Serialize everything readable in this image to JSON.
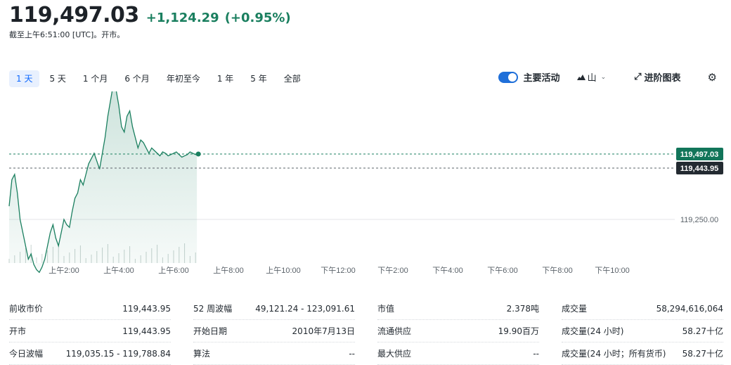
{
  "quote": {
    "price": "119,497.03",
    "change": "+1,124.29",
    "change_pct": "(+0.95%)",
    "as_of": "截至上午6:51:00 [UTC]。开市。"
  },
  "ranges": [
    {
      "label": "1 天",
      "active": true
    },
    {
      "label": "5 天",
      "active": false
    },
    {
      "label": "1 个月",
      "active": false
    },
    {
      "label": "6 个月",
      "active": false
    },
    {
      "label": "年初至今",
      "active": false
    },
    {
      "label": "1 年",
      "active": false
    },
    {
      "label": "5 年",
      "active": false
    },
    {
      "label": "全部",
      "active": false
    }
  ],
  "controls": {
    "key_events_label": "主要活动",
    "key_events_on": true,
    "chart_type_label": "山",
    "advanced_chart_label": "进阶图表"
  },
  "chart_data": {
    "type": "area",
    "current_price": 119497.03,
    "current_price_label": "119,497.03",
    "previous_close": 119443.95,
    "previous_close_label": "119,443.95",
    "y_ticks": [
      {
        "value": 119250,
        "label": "119,250.00"
      }
    ],
    "ylim": [
      119035,
      119788.84
    ],
    "x_ticks": [
      "上午2:00",
      "上午4:00",
      "上午6:00",
      "上午8:00",
      "上午10:00",
      "下午12:00",
      "下午2:00",
      "下午4:00",
      "下午6:00",
      "下午8:00",
      "下午10:00"
    ],
    "x_hours_range": [
      0,
      24
    ],
    "series": [
      {
        "x_hours": [
          0.0,
          0.1,
          0.2,
          0.3,
          0.4,
          0.5,
          0.6,
          0.7,
          0.8,
          0.9,
          1.0,
          1.1,
          1.2,
          1.3,
          1.4,
          1.5,
          1.6,
          1.7,
          1.8,
          1.9,
          2.0,
          2.1,
          2.2,
          2.3,
          2.4,
          2.5,
          2.6,
          2.7,
          2.8,
          2.9,
          3.0,
          3.1,
          3.2,
          3.3,
          3.4,
          3.5,
          3.6,
          3.7,
          3.8,
          3.9,
          4.0,
          4.1,
          4.2,
          4.3,
          4.4,
          4.5,
          4.6,
          4.7,
          4.8,
          4.9,
          5.0,
          5.1,
          5.2,
          5.3,
          5.4,
          5.5,
          5.6,
          5.7,
          5.8,
          5.9,
          6.0,
          6.1,
          6.2,
          6.3,
          6.4,
          6.5,
          6.6,
          6.7,
          6.8,
          6.85
        ],
        "values": [
          119300,
          119400,
          119420,
          119350,
          119250,
          119200,
          119150,
          119100,
          119120,
          119080,
          119060,
          119050,
          119070,
          119100,
          119150,
          119200,
          119230,
          119180,
          119150,
          119200,
          119250,
          119230,
          119220,
          119280,
          119330,
          119350,
          119400,
          119380,
          119420,
          119460,
          119480,
          119500,
          119470,
          119440,
          119500,
          119560,
          119640,
          119700,
          119760,
          119740,
          119680,
          119600,
          119580,
          119640,
          119660,
          119600,
          119560,
          119520,
          119550,
          119540,
          119520,
          119500,
          119520,
          119510,
          119500,
          119490,
          119505,
          119500,
          119490,
          119495,
          119500,
          119505,
          119495,
          119485,
          119490,
          119495,
          119505,
          119500,
          119495,
          119497.03
        ]
      }
    ]
  },
  "stats": [
    {
      "label": "前收市价",
      "value": "119,443.95"
    },
    {
      "label": "52 周波幅",
      "value": "49,121.24 - 123,091.61"
    },
    {
      "label": "市值",
      "value": "2.378吨"
    },
    {
      "label": "成交量",
      "value": "58,294,616,064"
    },
    {
      "label": "开市",
      "value": "119,443.95"
    },
    {
      "label": "开始日期",
      "value": "2010年7月13日"
    },
    {
      "label": "流通供应",
      "value": "19.90百万"
    },
    {
      "label": "成交量(24 小时)",
      "value": "58.27十亿"
    },
    {
      "label": "今日波幅",
      "value": "119,035.15 - 119,788.84"
    },
    {
      "label": "算法",
      "value": "--"
    },
    {
      "label": "最大供应",
      "value": "--"
    },
    {
      "label": "成交量(24 小时；所有货币)",
      "value": "58.27十亿"
    }
  ]
}
